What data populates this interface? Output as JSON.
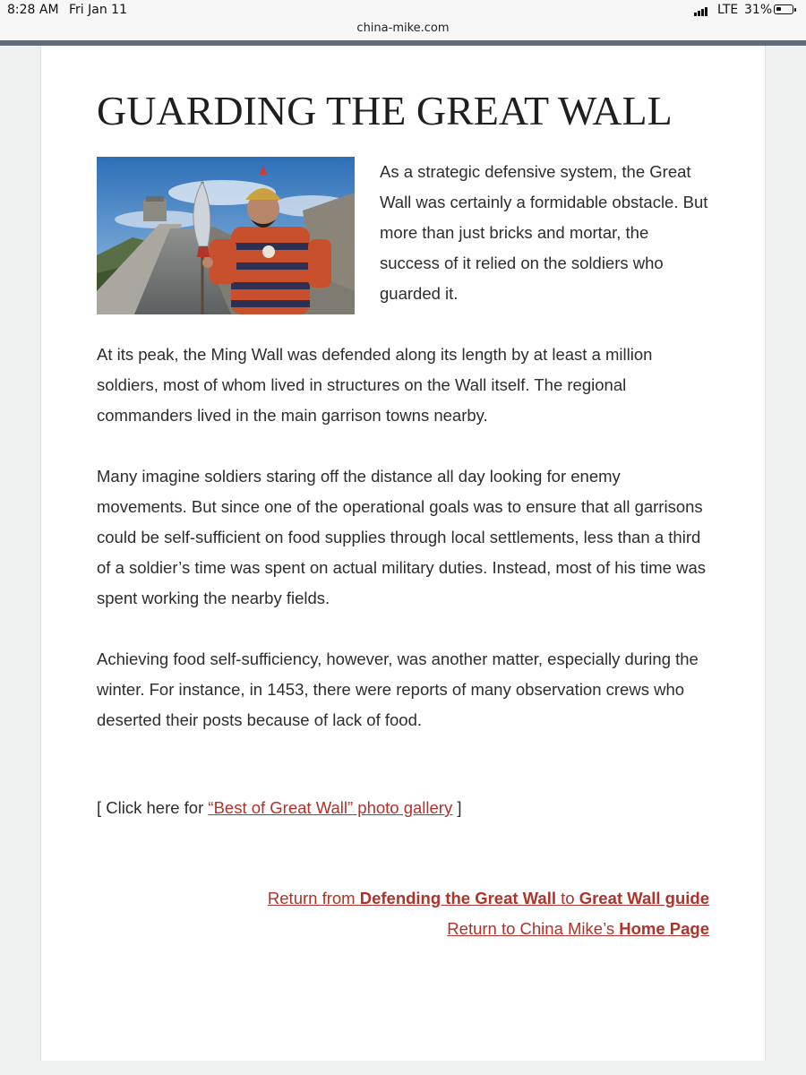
{
  "status_bar": {
    "time": "8:28 AM",
    "date": "Fri Jan 11",
    "network": "LTE",
    "battery": "31%",
    "battery_level": 0.31
  },
  "browser": {
    "url": "china-mike.com"
  },
  "article": {
    "title": "GUARDING THE GREAT WALL",
    "paragraphs": [
      "As a strategic defensive system, the Great Wall was certainly a formidable obstacle. But more than just bricks and mortar, the success of it relied on the soldiers who guarded it.",
      "At its peak, the Ming Wall was defended along its length by at least a million soldiers, most of whom lived in structures on the Wall itself. The regional commanders lived in the main garrison towns nearby.",
      "Many imagine soldiers staring off the distance all day looking for enemy movements. But since one of the operational goals was to ensure that all garrisons could be self-sufficient on food supplies through local settlements, less than a third of a soldier’s time was spent on actual military duties. Instead, most of his time was spent working the nearby fields.",
      "Achieving food self-sufficiency, however, was another matter, especially during the winter. For instance, in 1453, there were reports of many observation crews who deserted their posts because of lack of food."
    ]
  },
  "gallery": {
    "prefix": "[ Click here for ",
    "link": "“Best of Great Wall” photo gallery",
    "suffix": " ]"
  },
  "returns": {
    "line1_a": "Return from ",
    "line1_b": "Defending the Great Wall",
    "line1_c": " to ",
    "line1_d": "Great Wall guide",
    "line2_a": "Return to China Mike’s ",
    "line2_b": "Home Page"
  },
  "colors": {
    "link": "#b0322a",
    "header_band": "#5e6d78",
    "text": "#2d2d2d"
  }
}
